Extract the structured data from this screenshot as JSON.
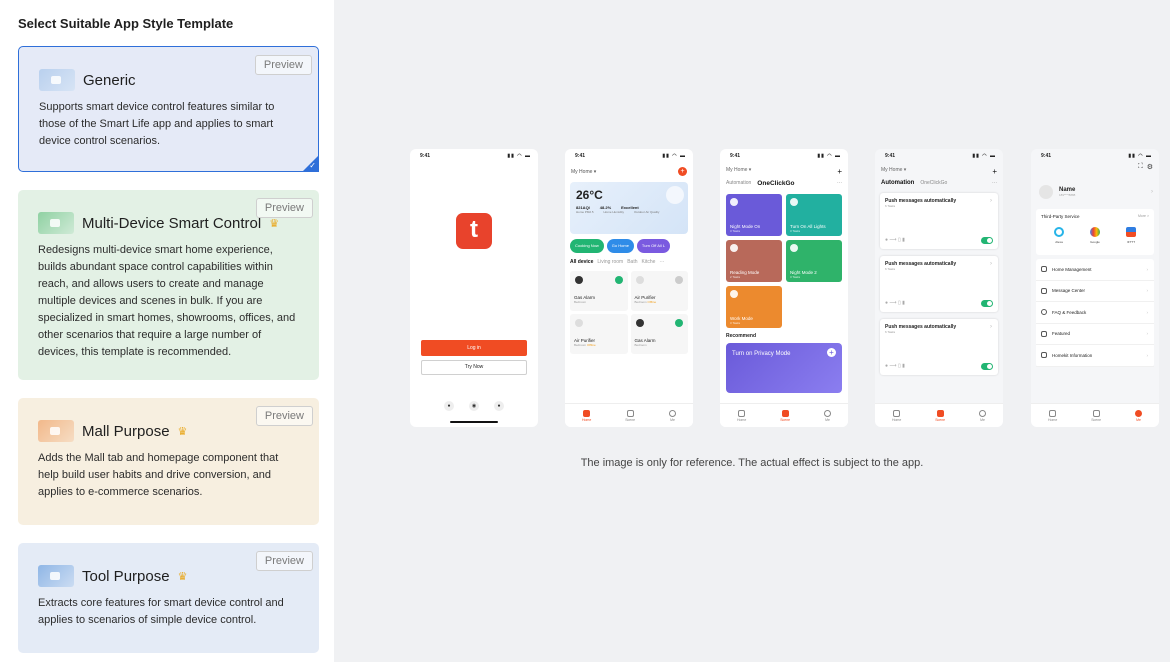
{
  "left": {
    "title": "Select Suitable App Style Template",
    "preview_label": "Preview",
    "crown_icon": "crown-icon",
    "cards": [
      {
        "title": "Generic",
        "desc": "Supports smart device control features similar to those of the Smart Life app and applies to smart device control scenarios.",
        "selected": true
      },
      {
        "title": "Multi-Device Smart Control",
        "desc": "Redesigns multi-device smart home experience, builds abundant space control capabilities within reach, and allows users to create and manage multiple devices and scenes in bulk. If you are specialized in smart homes, showrooms, offices, and other scenarios that require a large number of devices, this template is recommended.",
        "premium": true
      },
      {
        "title": "Mall Purpose",
        "desc": "Adds the Mall tab and homepage component that help build user habits and drive conversion, and applies to e-commerce scenarios.",
        "premium": true
      },
      {
        "title": "Tool Purpose",
        "desc": "Extracts core features for smart device control and applies to scenarios of simple device control.",
        "premium": true
      }
    ]
  },
  "phones": {
    "time": "9:41",
    "p1": {
      "login": "Log in",
      "try": "Try Now"
    },
    "p2": {
      "home": "My Home ▾",
      "temp": "26°C",
      "stats": [
        "821AQI",
        "48.2%",
        "Excellent"
      ],
      "stats_sub": [
        "Home PM2.5",
        "Home Humidity",
        "Outdoor Air Quality"
      ],
      "scenes": [
        "Cooking Now",
        "Go Home",
        "Turn Off All L"
      ],
      "rooms": [
        "All device",
        "Living room",
        "Bath",
        "Kitche",
        "···"
      ],
      "devices": [
        {
          "name": "Gas Alarm",
          "sub": "Bedroom"
        },
        {
          "name": "Air Purifier",
          "sub": "Bedroom",
          "warn": "Offline"
        },
        {
          "name": "Air Purifier",
          "sub": "Bedroom",
          "warn": "Offline"
        },
        {
          "name": "Gas Alarm",
          "sub": "Bedroom"
        }
      ],
      "tabs": [
        "Home",
        "Scene",
        "Me"
      ]
    },
    "p3": {
      "home": "My Home ▾",
      "tabs": [
        "Automation",
        "OneClickGo",
        "···"
      ],
      "scenes": [
        {
          "name": "Night Mode On",
          "tasks": "3 Tasks",
          "color": "#6a5ad9"
        },
        {
          "name": "Turn On All Lights",
          "tasks": "3 Tasks",
          "color": "#22b0a0"
        },
        {
          "name": "Reading Mode",
          "tasks": "2 Tasks",
          "color": "#b8695a"
        },
        {
          "name": "Night Mode 2",
          "tasks": "3 Tasks",
          "color": "#2fb36a"
        },
        {
          "name": "Work Mode",
          "tasks": "3 Tasks",
          "color": "#ec8a2e"
        }
      ],
      "recommend": "Recommend",
      "banner": "Turn on Privacy Mode",
      "tabs_bottom": [
        "Home",
        "Scene",
        "Me"
      ]
    },
    "p4": {
      "home": "My Home ▾",
      "tabs": [
        "Automation",
        "OneClickGo",
        "···"
      ],
      "auto_title": "Push messages automatically",
      "auto_sub": "6 Tasks",
      "tabs_bottom": [
        "Home",
        "Scene",
        "Me"
      ]
    },
    "p5": {
      "name": "Name",
      "num": "189****8888",
      "third": "Third-Party Service",
      "more": "More >",
      "services": [
        "Alexa",
        "Google",
        "IFTTT"
      ],
      "menu": [
        "Home Management",
        "Message Center",
        "FAQ & Feedback",
        "Featured",
        "Homekit Information"
      ],
      "tabs_bottom": [
        "Home",
        "Scene",
        "Me"
      ]
    }
  },
  "note": "The image is only for reference. The actual effect is subject to the app.",
  "colors": {
    "accent": "#2f6fd9",
    "brand": "#f04c23"
  }
}
